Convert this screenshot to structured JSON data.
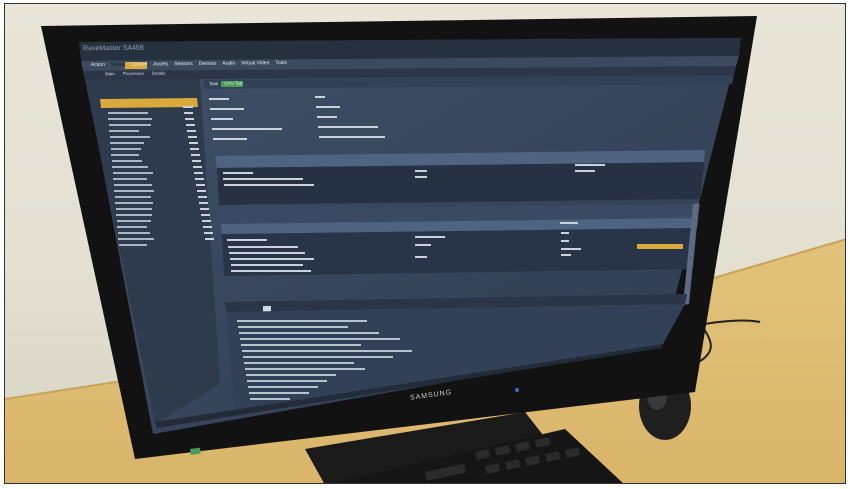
{
  "app": {
    "title": "RaveMaster SA458",
    "menu": [
      "Action",
      "Status",
      "Control",
      "Assets",
      "Sensors",
      "Devices",
      "Audio",
      "Virtual Video",
      "Tools"
    ],
    "subtabs": [
      "Main",
      "Processes",
      "Details"
    ],
    "detail_tabs": [
      "Task",
      "CPU Tab"
    ]
  },
  "monitor": {
    "brand": "SAMSUNG"
  },
  "colors": {
    "accent": "#d9a93b",
    "screen_bg": "#3a4a5e",
    "sidebar_bg": "#2e3b4d"
  }
}
